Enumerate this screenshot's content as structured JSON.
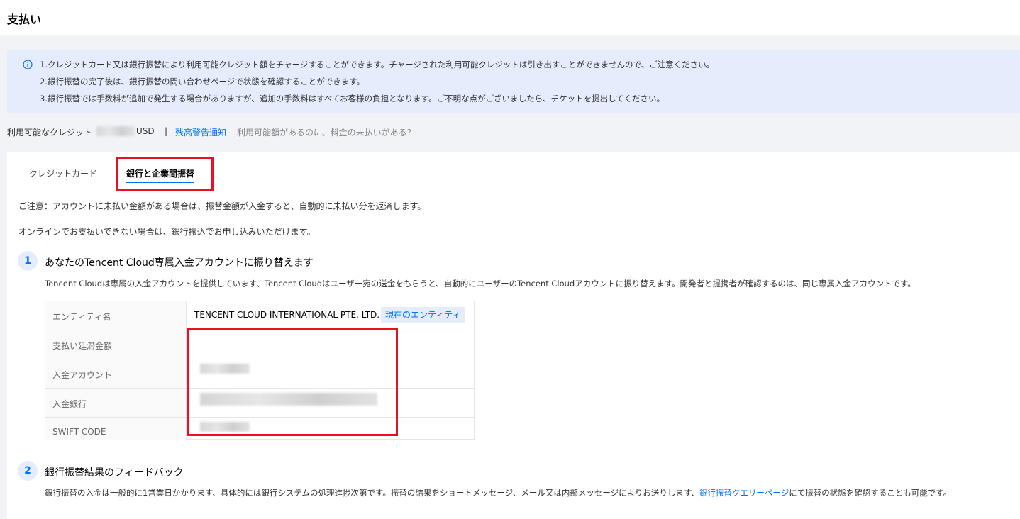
{
  "header": {
    "title": "支払い"
  },
  "notice": {
    "icon": "info-icon",
    "lines": [
      "1.クレジットカード又は銀行振替により利用可能クレジット額をチャージすることができます。チャージされた利用可能クレジットは引き出すことができませんので、ご注意ください。",
      "2.銀行振替の完了後は、銀行振替の問い合わせページで状態を確認することができます。",
      "3.銀行振替では手数料が追加で発生する場合がありますが、追加の手数料はすべてお客様の負担となります。ご不明な点がございましたら、チケットを提出してください。"
    ]
  },
  "credit": {
    "label": "利用可能なクレジット",
    "currency": "USD",
    "separator": "|",
    "alert_link": "残高警告通知",
    "question": "利用可能額があるのに、料金の未払いがある?"
  },
  "tabs": [
    {
      "label": "クレジットカード",
      "active": false
    },
    {
      "label": "銀行と企業間振替",
      "active": true
    }
  ],
  "intro": {
    "notice": "ご注意：アカウントに未払い金額がある場合は、振替金額が入金すると、自動的に未払い分を返済します。",
    "offline": "オンラインでお支払いできない場合は、銀行振込でお申し込みいただけます。"
  },
  "step1": {
    "number": "1",
    "title": "あなたのTencent Cloud専属入金アカウントに振り替えます",
    "desc": "Tencent Cloudは専属の入金アカウントを提供しています、Tencent Cloudはユーザー宛の送金をもらうと、自動的にユーザーのTencent Cloudアカウントに振り替えます。開発者と提携者が確認するのは、同じ専属入金アカウントです。",
    "table": {
      "entity_label": "エンティティ名",
      "entity_value": "TENCENT CLOUD INTERNATIONAL PTE. LTD.",
      "entity_badge": "現在のエンティティ",
      "overdue_label": "支払い延滞金額",
      "account_label": "入金アカウント",
      "bank_label": "入金銀行",
      "swift_label": "SWIFT CODE"
    }
  },
  "step2": {
    "number": "2",
    "title": "銀行振替結果のフィードバック",
    "desc_before": "銀行振替の入金は一般的に1営業日かかります、具体的には銀行システムの処理進捗次第です。振替の結果をショートメッセージ、メール又は内部メッセージによりお送りします、",
    "link": "銀行振替クエリーページ",
    "desc_after": "にて振替の状態を確認することも可能です。"
  },
  "colors": {
    "accent": "#006eff",
    "highlight": "#e81123",
    "notice_bg": "#e5edfd"
  }
}
